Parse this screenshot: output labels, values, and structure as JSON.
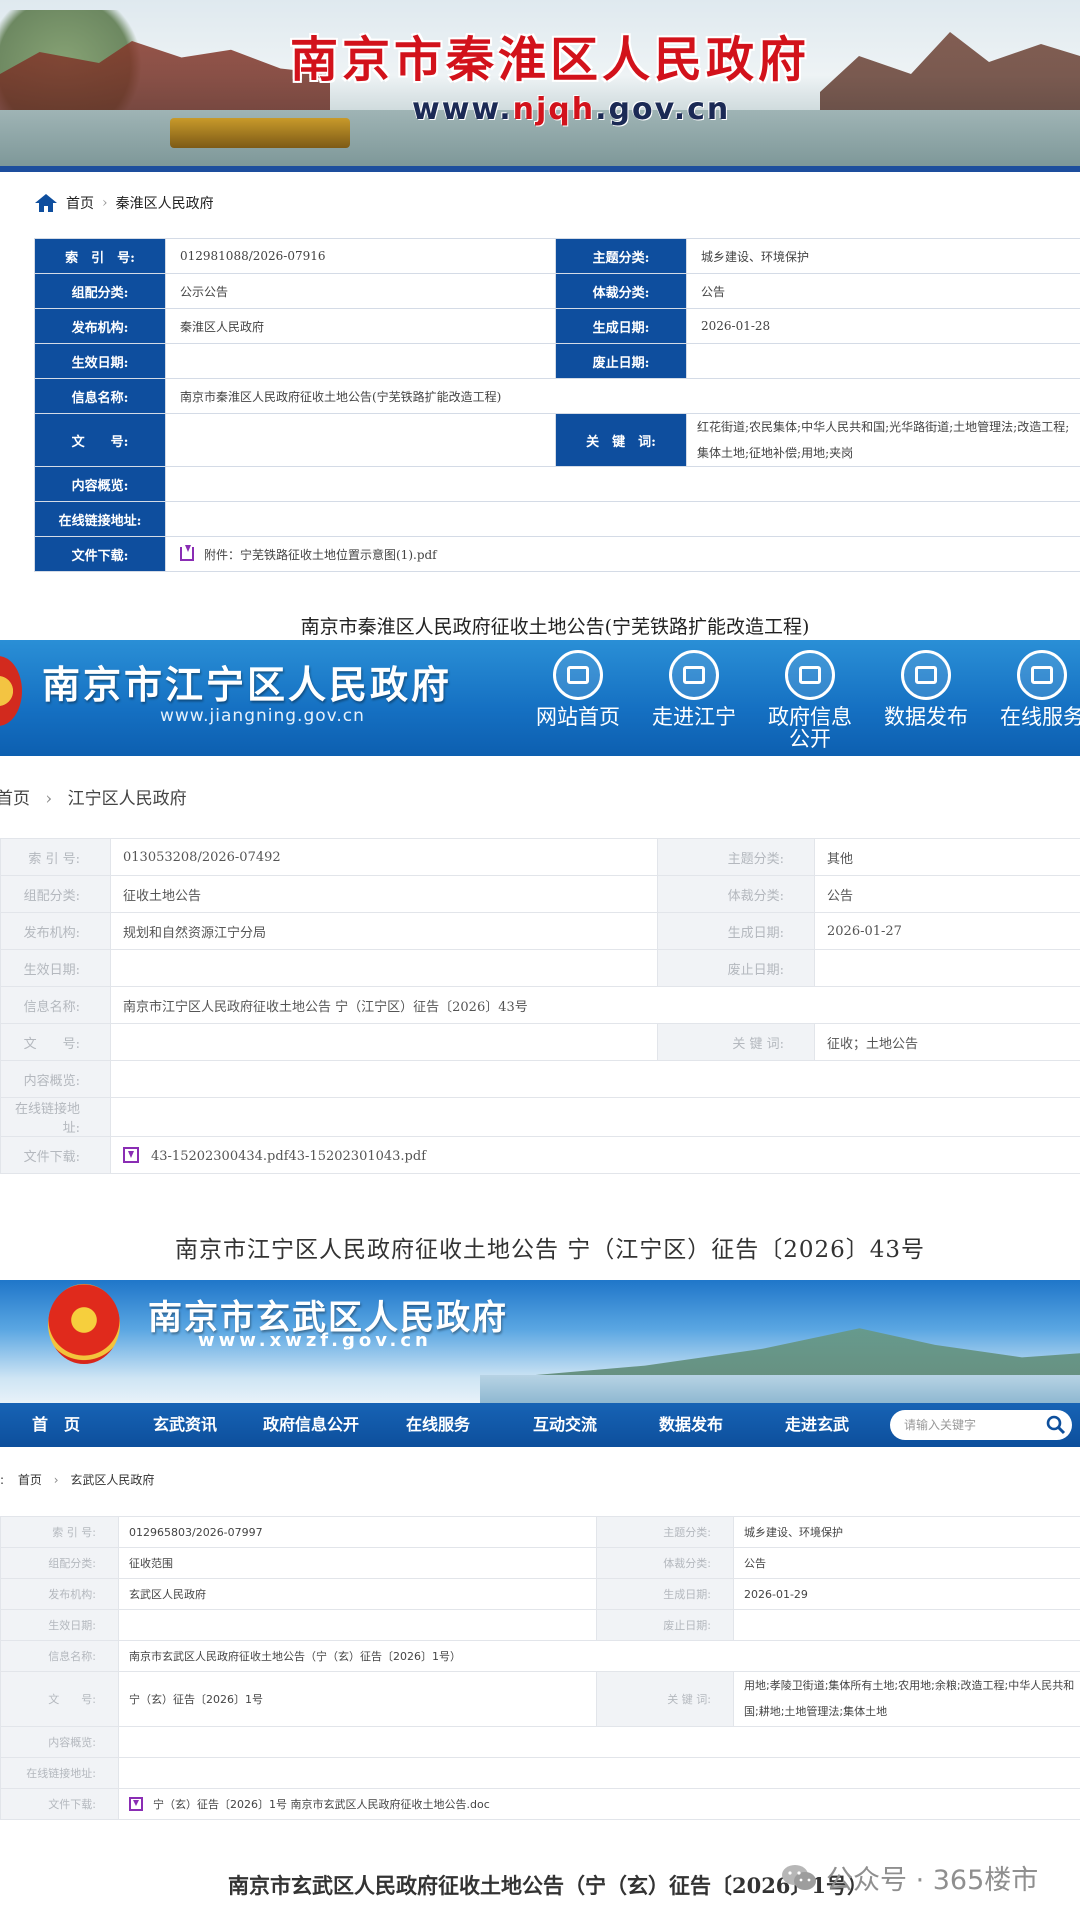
{
  "qinhuai": {
    "banner_title": "南京市秦淮区人民政府",
    "url_pre": "www.",
    "url_mid": "njqh",
    "url_post": ".gov.cn",
    "breadcrumb": {
      "home": "首页",
      "current": "秦淮区人民政府"
    },
    "labels": {
      "index_no": "索　引　号:",
      "subject": "主题分类:",
      "org_cat": "组配分类:",
      "genre": "体裁分类:",
      "publisher": "发布机构:",
      "created": "生成日期:",
      "effective": "生效日期:",
      "expiry": "废止日期:",
      "info_name": "信息名称:",
      "doc_no": "文　　号:",
      "keywords": "关　键　词:",
      "summary": "内容概览:",
      "link": "在线链接地址:",
      "download": "文件下载:"
    },
    "values": {
      "index_no": "012981088/2026-07916",
      "subject": "城乡建设、环境保护",
      "org_cat": "公示公告",
      "genre": "公告",
      "publisher": "秦淮区人民政府",
      "created": "2026-01-28",
      "info_name": "南京市秦淮区人民政府征收土地公告(宁芜铁路扩能改造工程)",
      "keywords": "红花街道;农民集体;中华人民共和国;光华路街道;土地管理法;改造工程;集体土地;征地补偿;用地;夹岗",
      "download": "附件：宁芜铁路征收土地位置示意图(1).pdf"
    },
    "doc_title": "南京市秦淮区人民政府征收土地公告(宁芜铁路扩能改造工程)"
  },
  "jiangning": {
    "banner_title": "南京市江宁区人民政府",
    "url": "www.jiangning.gov.cn",
    "nav": [
      {
        "label": "网站首页"
      },
      {
        "label": "走进江宁"
      },
      {
        "label": "政府信息公开"
      },
      {
        "label": "数据发布"
      },
      {
        "label": "在线服务"
      }
    ],
    "breadcrumb": {
      "home": "首页",
      "current": "江宁区人民政府"
    },
    "labels": {
      "index_no": "索 引 号:",
      "subject": "主题分类:",
      "org_cat": "组配分类:",
      "genre": "体裁分类:",
      "publisher": "发布机构:",
      "created": "生成日期:",
      "effective": "生效日期:",
      "expiry": "废止日期:",
      "info_name": "信息名称:",
      "doc_no": "文　　号:",
      "keywords": "关 键 词:",
      "summary": "内容概览:",
      "link": "在线链接地址:",
      "download": "文件下载:"
    },
    "values": {
      "index_no": "013053208/2026-07492",
      "subject": "其他",
      "org_cat": "征收土地公告",
      "genre": "公告",
      "publisher": "规划和自然资源江宁分局",
      "created": "2026-01-27",
      "info_name": "南京市江宁区人民政府征收土地公告 宁（江宁区）征告〔2026〕43号",
      "keywords": "征收；土地公告",
      "download": "43-15202300434.pdf43-15202301043.pdf"
    },
    "doc_title": "南京市江宁区人民政府征收土地公告 宁（江宁区）征告〔2026〕43号"
  },
  "xuanwu": {
    "banner_title": "南京市玄武区人民政府",
    "url": "www.xwzf.gov.cn",
    "nav": [
      {
        "label": "首　页"
      },
      {
        "label": "玄武资讯"
      },
      {
        "label": "政府信息公开"
      },
      {
        "label": "在线服务"
      },
      {
        "label": "互动交流"
      },
      {
        "label": "数据发布"
      },
      {
        "label": "走进玄武"
      }
    ],
    "search_placeholder": "请输入关键字",
    "breadcrumb": {
      "prefix": "置:",
      "home": "首页",
      "current": "玄武区人民政府"
    },
    "labels": {
      "index_no": "索 引 号:",
      "subject": "主题分类:",
      "org_cat": "组配分类:",
      "genre": "体裁分类:",
      "publisher": "发布机构:",
      "created": "生成日期:",
      "effective": "生效日期:",
      "expiry": "废止日期:",
      "info_name": "信息名称:",
      "doc_no": "文　　号:",
      "keywords": "关 键 词:",
      "summary": "内容概览:",
      "link": "在线链接地址:",
      "download": "文件下载:"
    },
    "values": {
      "index_no": "012965803/2026-07997",
      "subject": "城乡建设、环境保护",
      "org_cat": "征收范围",
      "genre": "公告",
      "publisher": "玄武区人民政府",
      "created": "2026-01-29",
      "info_name": "南京市玄武区人民政府征收土地公告（宁（玄）征告〔2026〕1号）",
      "doc_no": "宁（玄）征告〔2026〕1号",
      "keywords": "用地;孝陵卫街道;集体所有土地;农用地;余粮;改造工程;中华人民共和国;耕地;土地管理法;集体土地",
      "download": "宁（玄）征告〔2026〕1号 南京市玄武区人民政府征收土地公告.doc"
    },
    "doc_title": "南京市玄武区人民政府征收土地公告（宁（玄）征告〔2026〕1号）",
    "watermark": "公众号 · 365楼市"
  },
  "colors": {
    "qinhuai_label_bg": "#0e4e9e",
    "qinhuai_title": "#d2121b",
    "jiangning_banner": "#1570c2",
    "xuanwu_nav": "#0d4f9c",
    "download_icon": "#8a2db4"
  }
}
